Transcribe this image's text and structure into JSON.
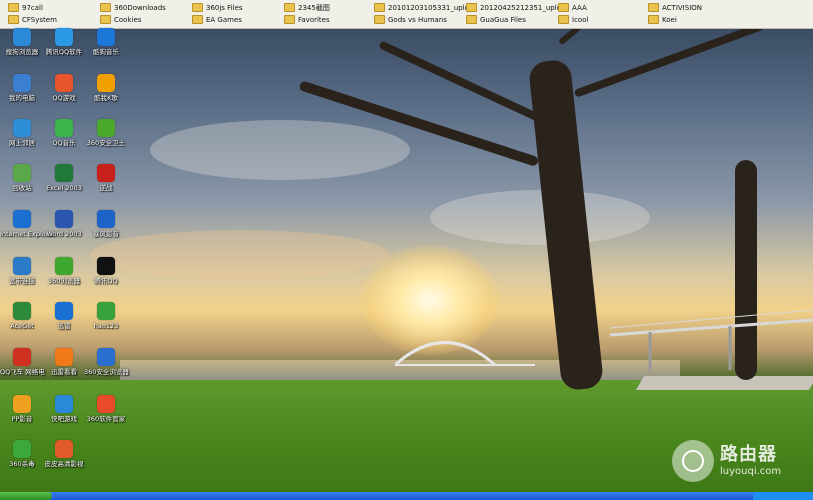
{
  "folder_bar": {
    "row1": [
      "97call",
      "360Downloads",
      "360js Files",
      "2345截图",
      "20101203105331_uplo...",
      "20120425212351_uplo...",
      "AAA",
      "ACTIVISION"
    ],
    "row2": [
      "CFSystem",
      "Cookies",
      "EA Games",
      "Favorites",
      "Gods vs Humans",
      "GuaGua Files",
      "Icool",
      "Koei"
    ]
  },
  "desktop_icons": [
    {
      "label": "搜狗浏览器",
      "icon": "browser-icon",
      "color": "#2a8ad8"
    },
    {
      "label": "腾讯QQ软件",
      "icon": "qq-software-icon",
      "color": "#2b9ae6"
    },
    {
      "label": "酷狗音乐",
      "icon": "kugou-icon",
      "color": "#1b78d8"
    },
    {
      "label": "我的电脑",
      "icon": "my-computer-icon",
      "color": "#3a7fd0"
    },
    {
      "label": "QQ游戏",
      "icon": "qq-game-icon",
      "color": "#e8552b"
    },
    {
      "label": "酷我K歌",
      "icon": "kuwo-karaoke-icon",
      "color": "#f2a000"
    },
    {
      "label": "网上邻居",
      "icon": "network-icon",
      "color": "#2f8fd6"
    },
    {
      "label": "QQ音乐",
      "icon": "qq-music-icon",
      "color": "#3ab54a"
    },
    {
      "label": "360安全卫士",
      "icon": "360-safe-icon",
      "color": "#4aa82b"
    },
    {
      "label": "回收站",
      "icon": "recycle-bin-icon",
      "color": "#5aa84a"
    },
    {
      "label": "Excel 2003",
      "icon": "excel-icon",
      "color": "#1f7a3a"
    },
    {
      "label": "逆战",
      "icon": "game-nizhan-icon",
      "color": "#c8201a"
    },
    {
      "label": "Internet Explorer",
      "icon": "ie-icon",
      "color": "#1a6fd0"
    },
    {
      "label": "Word 2003",
      "icon": "word-icon",
      "color": "#2a55b0"
    },
    {
      "label": "暴风影音",
      "icon": "storm-player-icon",
      "color": "#1e63c8"
    },
    {
      "label": "宽带连接",
      "icon": "broadband-icon",
      "color": "#2a7ac8"
    },
    {
      "label": "360浏览器",
      "icon": "360-browser-icon",
      "color": "#3fa62e"
    },
    {
      "label": "腾讯QQ",
      "icon": "qq-penguin-icon",
      "color": "#111111"
    },
    {
      "label": "AceGet",
      "icon": "aceget-icon",
      "color": "#2d8a3a"
    },
    {
      "label": "迅雷",
      "icon": "xunlei-icon",
      "color": "#1a6fd0"
    },
    {
      "label": "hao123",
      "icon": "hao123-icon",
      "color": "#38a23a"
    },
    {
      "label": "QQ飞车 网络电",
      "icon": "network-tv-icon",
      "color": "#d03020"
    },
    {
      "label": "迅雷看看",
      "icon": "xunlei-kankan-icon",
      "color": "#f07a1a"
    },
    {
      "label": "360安全浏览器",
      "icon": "360-se-icon",
      "color": "#2a6fd0"
    },
    {
      "label": "PP影音",
      "icon": "pp-player-icon",
      "color": "#f0a020"
    },
    {
      "label": "快吧游戏",
      "icon": "kuaiba-game-icon",
      "color": "#2a8ad8"
    },
    {
      "label": "360软件管家",
      "icon": "360-manager-icon",
      "color": "#e84a2a"
    },
    {
      "label": "360杀毒",
      "icon": "360-antivirus-icon",
      "color": "#3aa83a"
    },
    {
      "label": "皮皮高清影视",
      "icon": "pipi-video-icon",
      "color": "#e05a2a"
    }
  ],
  "watermark": {
    "brand": "路由器",
    "url": "luyouqi.com"
  }
}
